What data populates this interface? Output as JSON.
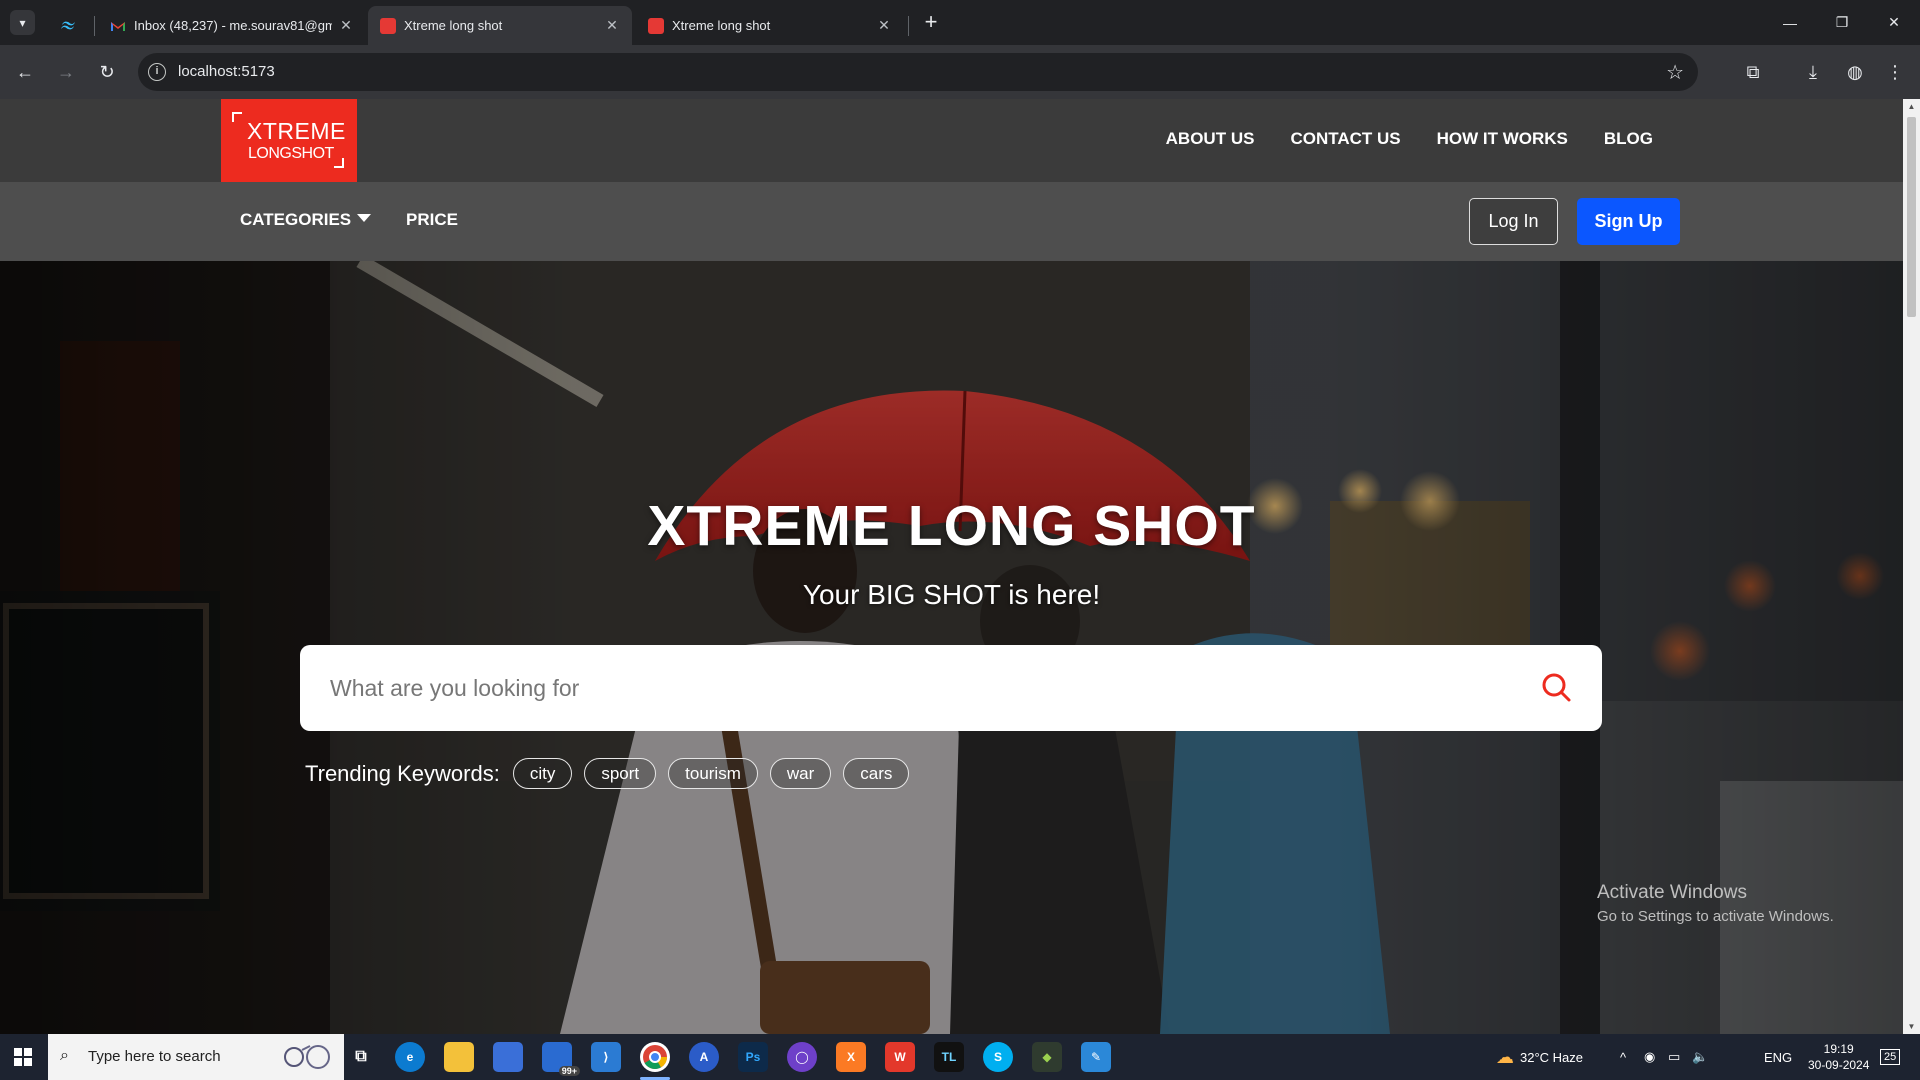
{
  "browser": {
    "tabs": [
      {
        "title": "",
        "icon": "tailwind-icon"
      },
      {
        "title": "Inbox (48,237) - me.sourav81@gm",
        "icon": "gmail-icon"
      },
      {
        "title": "Xtreme long shot",
        "icon": "site-favicon",
        "active": true
      },
      {
        "title": "Xtreme long shot",
        "icon": "site-favicon"
      }
    ],
    "url": "localhost:5173"
  },
  "site": {
    "logo": {
      "line1": "XTREME",
      "line2": "LONGSHOT"
    },
    "top_links": [
      "ABOUT US",
      "CONTACT US",
      "HOW IT WORKS",
      "BLOG"
    ],
    "sub_nav": {
      "categories": "CATEGORIES",
      "price": "PRICE"
    },
    "login": "Log In",
    "signup": "Sign Up",
    "hero": {
      "title": "XTREME LONG SHOT",
      "subtitle": "Your BIG SHOT is here!",
      "search_placeholder": "What are you looking for",
      "trending_label": "Trending Keywords:",
      "keywords": [
        "city",
        "sport",
        "tourism",
        "war",
        "cars"
      ]
    },
    "watermark": {
      "line1": "Activate Windows",
      "line2": "Go to Settings to activate Windows."
    },
    "colors": {
      "brand": "#ed2b1f",
      "signup": "#0b57ff",
      "search_icon": "#ed2b1f"
    }
  },
  "taskbar": {
    "search_text": "Type here to search",
    "badge": "99+",
    "weather": "32°C  Haze",
    "language": "ENG",
    "time": "19:19",
    "date": "30-09-2024",
    "notifications": "25"
  }
}
